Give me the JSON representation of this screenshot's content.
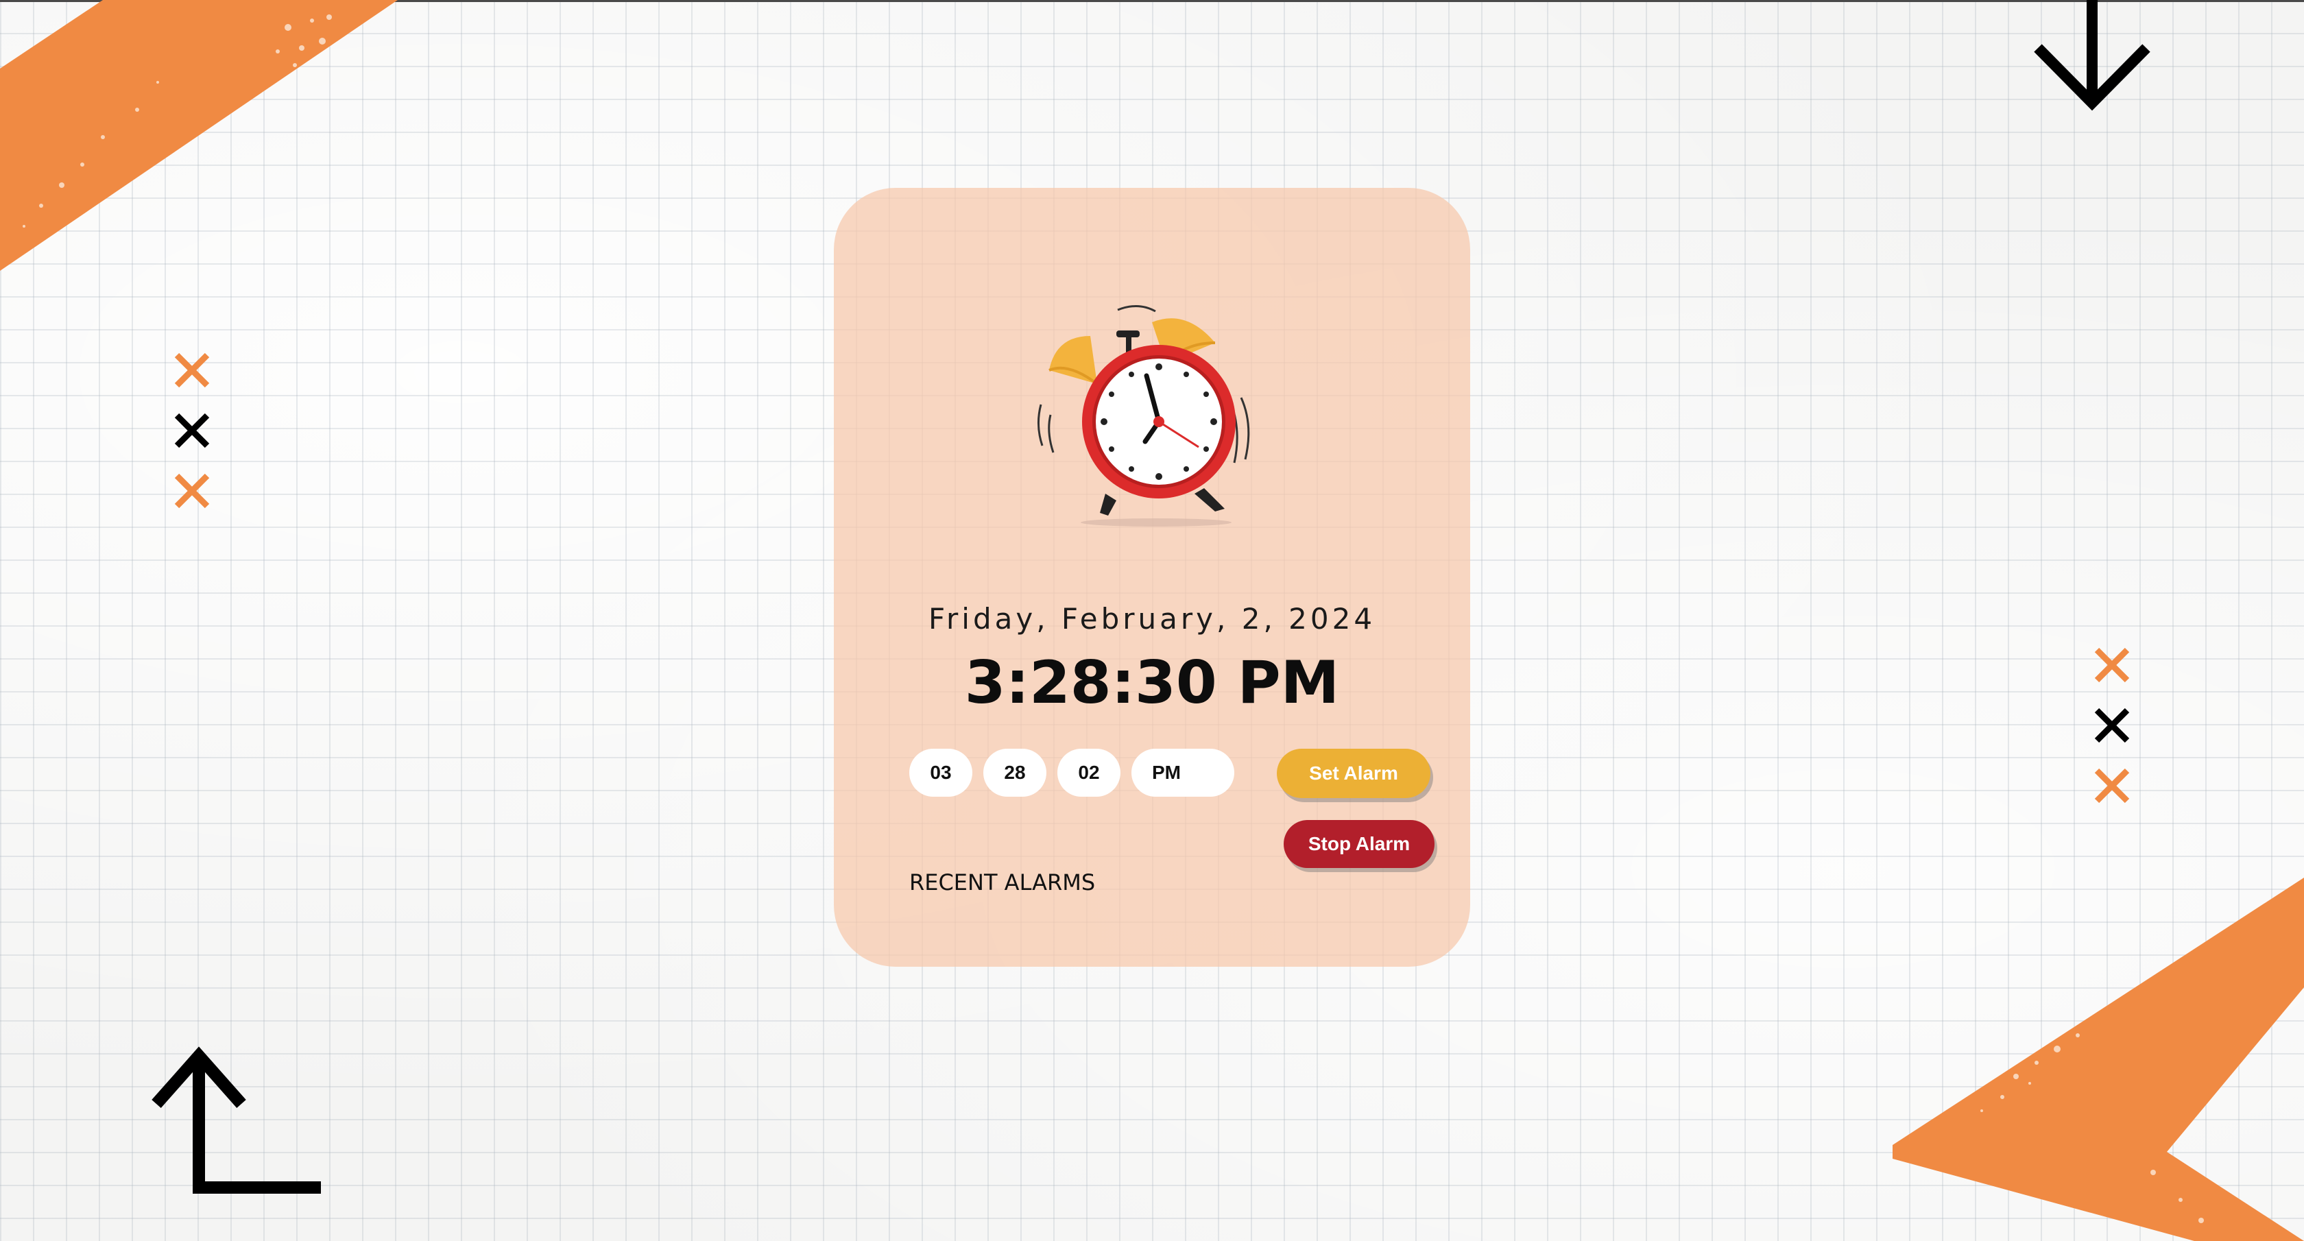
{
  "alarm_card": {
    "date": "Friday, February, 2, 2024",
    "current_time": "3:28:30 PM",
    "inputs": {
      "hour": "03",
      "minute": "28",
      "second": "02",
      "period": "PM"
    },
    "set_button_label": "Set Alarm",
    "stop_button_label": "Stop Alarm",
    "recent_alarms_heading": "RECENT ALARMS"
  },
  "colors": {
    "card_background": "#f7c8aa",
    "set_button": "#ecb035",
    "stop_button": "#b21f2b",
    "accent_orange": "#f08a43",
    "clock_red": "#dc2b2b",
    "bell_yellow": "#f3b33d"
  },
  "icons": [
    "alarm-clock-illustration",
    "arrow-down-icon",
    "corner-arrow-icon",
    "x-mark-icon"
  ]
}
